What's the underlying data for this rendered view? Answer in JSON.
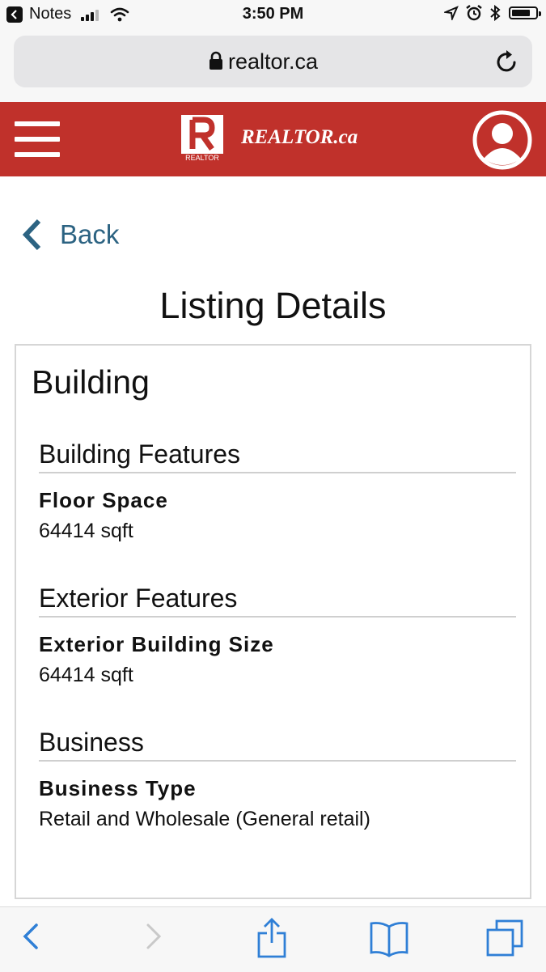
{
  "status_bar": {
    "back_app_label": "Notes",
    "time": "3:50 PM"
  },
  "browser": {
    "url": "realtor.ca"
  },
  "header": {
    "logo_text": "REALTOR",
    "brand": "REALTOR.ca"
  },
  "page": {
    "back_label": "Back",
    "title": "Listing Details"
  },
  "card": {
    "title": "Building",
    "sections": [
      {
        "heading": "Building Features",
        "field_label": "Floor Space",
        "field_value": "64414 sqft"
      },
      {
        "heading": "Exterior Features",
        "field_label": "Exterior Building Size",
        "field_value": "64414 sqft"
      },
      {
        "heading": "Business",
        "field_label": "Business Type",
        "field_value": "Retail and Wholesale (General retail)"
      }
    ]
  },
  "icons": {
    "status": [
      "back-app-icon",
      "signal-icon",
      "wifi-icon",
      "location-icon",
      "alarm-icon",
      "bluetooth-icon",
      "battery-icon"
    ],
    "toolbar": [
      "back-icon",
      "forward-icon",
      "share-icon",
      "bookmarks-icon",
      "tabs-icon"
    ]
  },
  "colors": {
    "brand_red": "#c0312b",
    "link_blue": "#2c6382",
    "toolbar_blue": "#2f7fd6"
  }
}
